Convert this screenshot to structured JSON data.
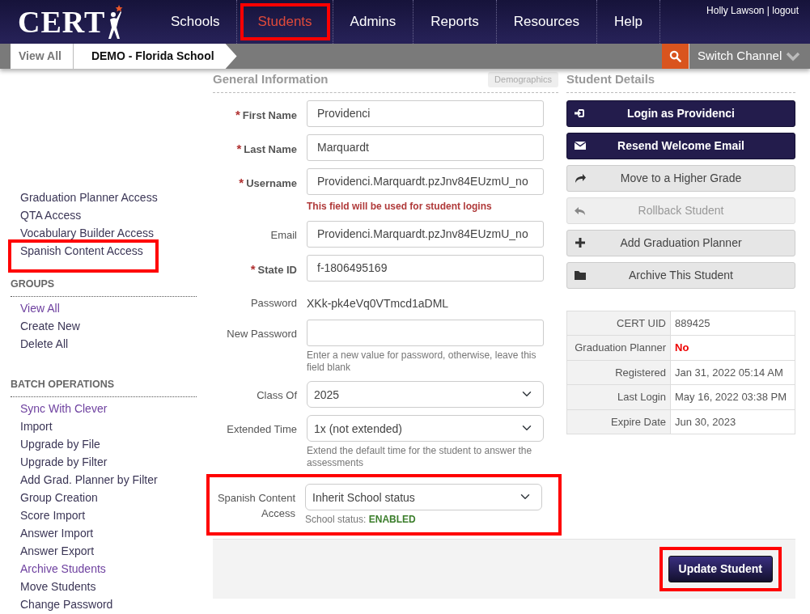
{
  "header": {
    "logo": "CERT",
    "nav": [
      {
        "label": "Schools",
        "selected": false,
        "highlighted": false
      },
      {
        "label": "Students",
        "selected": true,
        "highlighted": true
      },
      {
        "label": "Admins",
        "selected": false,
        "highlighted": false
      },
      {
        "label": "Reports",
        "selected": false,
        "highlighted": false
      },
      {
        "label": "Resources",
        "selected": false,
        "highlighted": false
      },
      {
        "label": "Help",
        "selected": false,
        "highlighted": false
      }
    ],
    "user_name": "Holly Lawson",
    "separator": "|",
    "logout": "logout"
  },
  "breadcrumb": [
    {
      "label": "View All",
      "current": false
    },
    {
      "label": "DEMO - Florida School",
      "current": true
    }
  ],
  "switch_channel": "Switch Channel",
  "sidebar": {
    "items": [
      {
        "label": "Graduation Planner Access",
        "visited": false,
        "highlighted": false
      },
      {
        "label": "QTA Access",
        "visited": false,
        "highlighted": false
      },
      {
        "label": "Vocabulary Builder Access",
        "visited": false,
        "highlighted": false
      },
      {
        "label": "Spanish Content Access",
        "visited": false,
        "highlighted": true
      }
    ],
    "sections": [
      {
        "title": "GROUPS",
        "items": [
          {
            "label": "View All",
            "visited": true
          },
          {
            "label": "Create New",
            "visited": false
          },
          {
            "label": "Delete All",
            "visited": false
          }
        ]
      },
      {
        "title": "BATCH OPERATIONS",
        "items": [
          {
            "label": "Sync With Clever",
            "visited": true
          },
          {
            "label": "Import",
            "visited": false
          },
          {
            "label": "Upgrade by File",
            "visited": false
          },
          {
            "label": "Upgrade by Filter",
            "visited": false
          },
          {
            "label": "Add Grad. Planner by Filter",
            "visited": false
          },
          {
            "label": "Group Creation",
            "visited": false
          },
          {
            "label": "Score Import",
            "visited": false
          },
          {
            "label": "Answer Import",
            "visited": false
          },
          {
            "label": "Answer Export",
            "visited": false
          },
          {
            "label": "Archive Students",
            "visited": true
          },
          {
            "label": "Move Students",
            "visited": false
          },
          {
            "label": "Change Password",
            "visited": false
          }
        ]
      }
    ]
  },
  "general_information": {
    "title": "General Information",
    "tab": "Demographics",
    "fields": [
      {
        "kind": "input",
        "label": "First Name",
        "required_mark": "*",
        "value": "Providenci"
      },
      {
        "kind": "input",
        "label": "Last Name",
        "required_mark": "*",
        "value": "Marquardt"
      },
      {
        "kind": "input",
        "label": "Username",
        "required_mark": "*",
        "value": "Providenci.Marquardt.pzJnv84EUzmU_no",
        "note": "This field will be used for student logins"
      },
      {
        "kind": "input",
        "label": "Email",
        "value": "Providenci.Marquardt.pzJnv84EUzmU_no"
      },
      {
        "kind": "input",
        "label": "State ID",
        "required_mark": "*",
        "value": "f-1806495169"
      },
      {
        "kind": "text",
        "label": "Password",
        "value": "XKk-pk4eVq0VTmcd1aDML"
      },
      {
        "kind": "input",
        "label": "New Password",
        "hint": "Enter a new value for password, otherwise, leave this field blank"
      },
      {
        "kind": "select",
        "label": "Class Of",
        "value": "2025"
      },
      {
        "kind": "select",
        "label": "Extended Time",
        "value": "1x (not extended)",
        "hint": "Extend the default time for the student to answer the assessments"
      },
      {
        "kind": "select",
        "label": "Spanish Content Access",
        "value": "Inherit School status",
        "hint": "School status:",
        "status": "ENABLED",
        "highlighted": true
      }
    ]
  },
  "student_details": {
    "title": "Student Details",
    "actions": [
      {
        "label": "Login as Providenci",
        "disabled": false
      },
      {
        "label": "Resend Welcome Email",
        "disabled": false
      },
      {
        "label": "Move to a Higher Grade",
        "disabled": false
      },
      {
        "label": "Rollback Student",
        "disabled": true
      },
      {
        "label": "Add Graduation Planner",
        "disabled": false
      },
      {
        "label": "Archive This Student",
        "disabled": false
      }
    ],
    "info": [
      {
        "label": "CERT UID",
        "value": "889425",
        "alert": false
      },
      {
        "label": "Graduation Planner",
        "value": "No",
        "alert": true
      },
      {
        "label": "Registered",
        "value": "Jan 31, 2022 05:14 AM",
        "alert": false
      },
      {
        "label": "Last Login",
        "value": "May 16, 2022 03:38 PM",
        "alert": false
      },
      {
        "label": "Expire Date",
        "value": "Jun 30, 2023",
        "alert": false
      }
    ]
  },
  "footer": {
    "submit": {
      "label": "Update Student",
      "highlighted": true
    }
  }
}
